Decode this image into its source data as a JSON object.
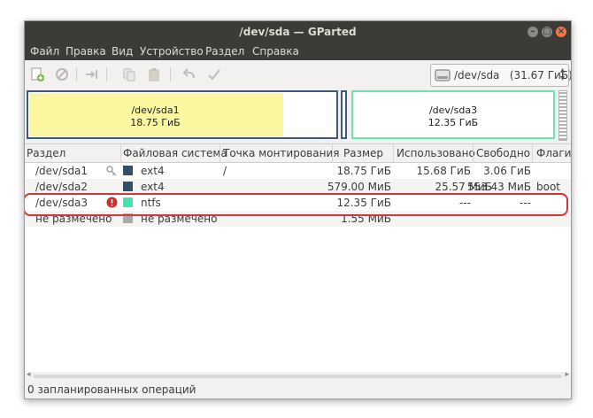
{
  "window": {
    "title": "/dev/sda — GParted"
  },
  "menu": [
    "Файл",
    "Правка",
    "Вид",
    "Устройство",
    "Раздел",
    "Справка"
  ],
  "toolbar": {
    "icons": [
      "new-partition-icon",
      "delete-icon",
      "resize-move-icon",
      "copy-icon",
      "paste-icon",
      "undo-icon",
      "apply-icon"
    ],
    "device": {
      "label": "/dev/sda   (31.67 ГиБ)",
      "icon": "hard-disk-icon"
    }
  },
  "graph": [
    {
      "name": "/dev/sda1",
      "size": "18.75 ГиБ",
      "color": "#fbf7a1"
    },
    {
      "name": "/dev/sda3",
      "size": "12.35 ГиБ",
      "color": "#6fe2b3"
    }
  ],
  "table": {
    "headers": [
      "Раздел",
      "Файловая система",
      "Точка монтирования",
      "Размер",
      "Использовано",
      "Свободно",
      "Флаги"
    ],
    "rows": [
      {
        "partition": "/dev/sda1",
        "fs": "ext4",
        "mount": "/",
        "size": "18.75 ГиБ",
        "used": "15.68 ГиБ",
        "free": "3.06 ГиБ",
        "flags": "",
        "fs_color": "#314e6c",
        "badge": "key-icon"
      },
      {
        "partition": "/dev/sda2",
        "fs": "ext4",
        "mount": "",
        "size": "579.00 МиБ",
        "used": "25.57 МиБ",
        "free": "553.43 МиБ",
        "flags": "boot",
        "fs_color": "#314e6c",
        "badge": ""
      },
      {
        "partition": "/dev/sda3",
        "fs": "ntfs",
        "mount": "",
        "size": "12.35 ГиБ",
        "used": "---",
        "free": "---",
        "flags": "",
        "fs_color": "#42e5ac",
        "badge": "warning-icon"
      },
      {
        "partition": "не размечено",
        "fs": "не размечено",
        "mount": "",
        "size": "1.55 МиБ",
        "used": "",
        "free": "",
        "flags": "",
        "fs_color": "#a9a9a9",
        "badge": ""
      }
    ]
  },
  "status": {
    "text": "0 запланированных операций"
  }
}
